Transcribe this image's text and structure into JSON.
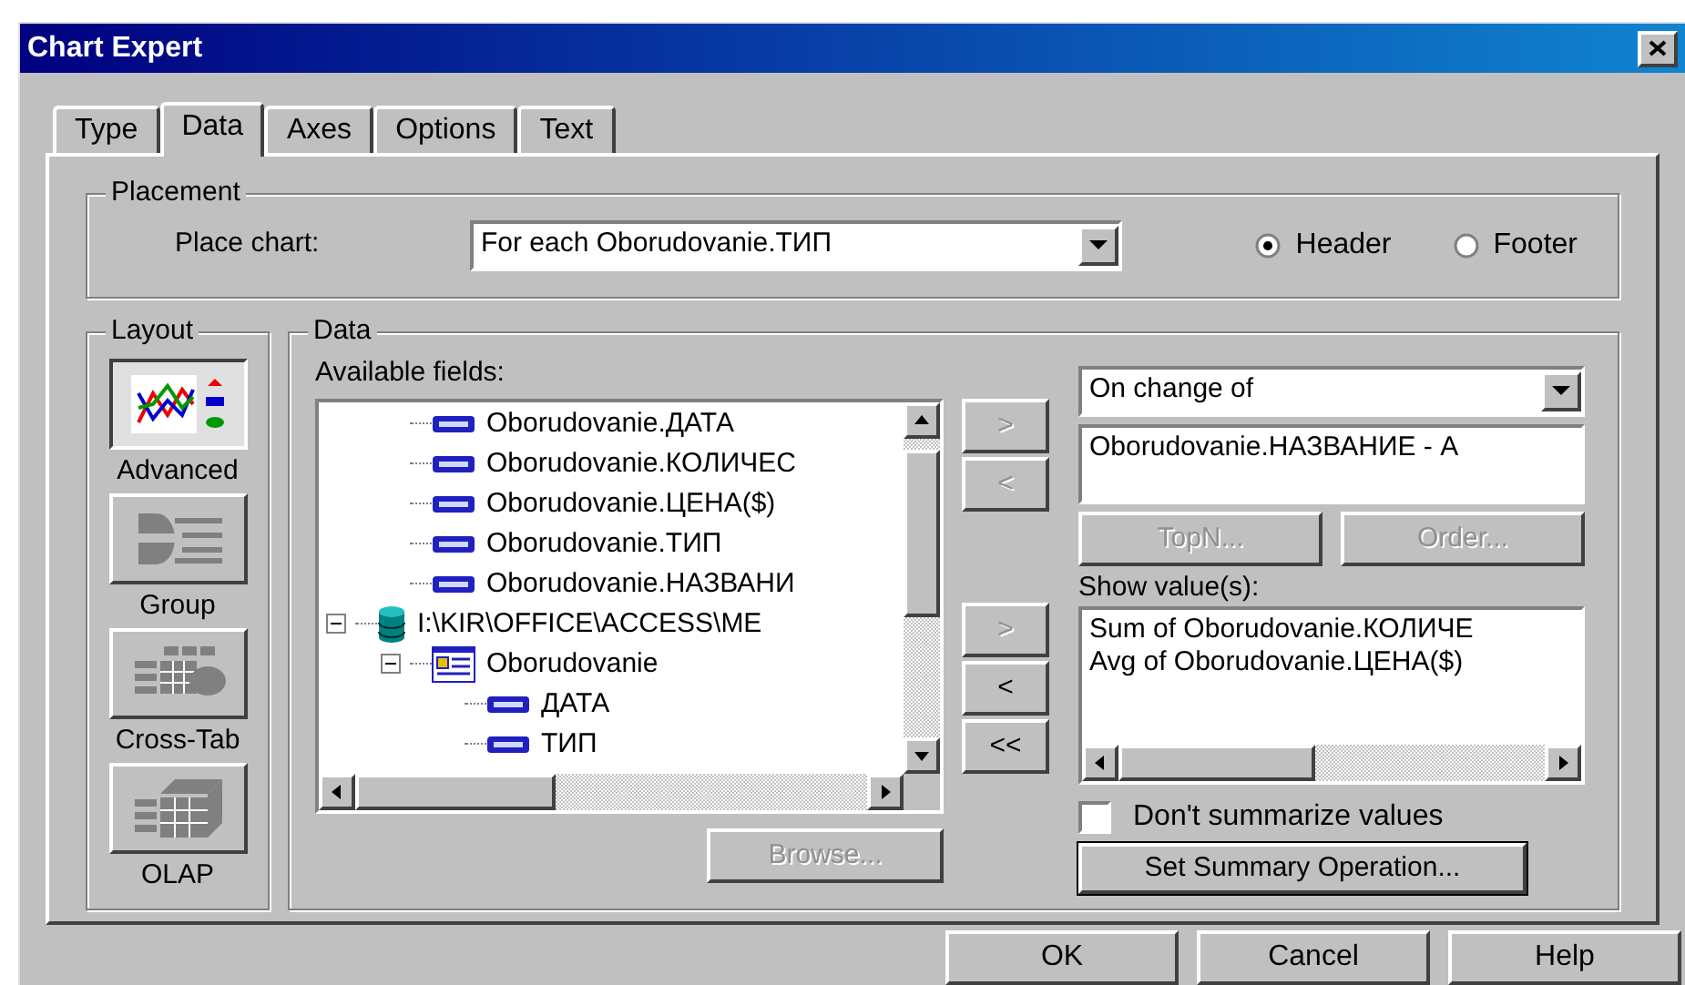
{
  "window": {
    "title": "Chart Expert"
  },
  "tabs": [
    {
      "label": "Type",
      "selected": false
    },
    {
      "label": "Data",
      "selected": true
    },
    {
      "label": "Axes",
      "selected": false
    },
    {
      "label": "Options",
      "selected": false
    },
    {
      "label": "Text",
      "selected": false
    }
  ],
  "placement": {
    "label": "Placement",
    "place_chart_label": "Place chart:",
    "place_chart_value": "For each Oborudovanie.ТИП",
    "radios": [
      {
        "label": "Header",
        "selected": true
      },
      {
        "label": "Footer",
        "selected": false
      }
    ]
  },
  "layout": {
    "label": "Layout",
    "items": [
      {
        "kind": "advanced",
        "label": "Advanced",
        "selected": true
      },
      {
        "kind": "group",
        "label": "Group",
        "selected": false
      },
      {
        "kind": "crosstab",
        "label": "Cross-Tab",
        "selected": false
      },
      {
        "kind": "olap",
        "label": "OLAP",
        "selected": false
      }
    ]
  },
  "data": {
    "label": "Data",
    "available_fields_label": "Available fields:",
    "tree": {
      "scrolled_branch": [
        {
          "kind": "field",
          "label": "Oborudovanie.ДАТА"
        },
        {
          "kind": "field",
          "label": "Oborudovanie.КОЛИЧЕС"
        },
        {
          "kind": "field",
          "label": "Oborudovanie.ЦЕНА($)"
        },
        {
          "kind": "field",
          "label": "Oborudovanie.ТИП"
        },
        {
          "kind": "field",
          "label": "Oborudovanie.НАЗВАНИ"
        }
      ],
      "nodes": [
        {
          "kind": "database",
          "label": "I:\\KIR\\OFFICE\\ACCESS\\ME",
          "expanded": true,
          "children": [
            {
              "kind": "table",
              "label": "Oborudovanie",
              "expanded": true,
              "children": [
                {
                  "kind": "field",
                  "label": "ДАТА"
                },
                {
                  "kind": "field",
                  "label": "ТИП"
                }
              ]
            }
          ]
        }
      ]
    },
    "browse_button": {
      "label": "Browse...",
      "disabled": true
    },
    "group_move_buttons": [
      {
        "label": ">",
        "disabled": true
      },
      {
        "label": "<",
        "disabled": true
      }
    ],
    "value_move_buttons": [
      {
        "label": ">",
        "disabled": true
      },
      {
        "label": "<",
        "disabled": false
      },
      {
        "label": "<<",
        "disabled": false
      }
    ],
    "on_change_dropdown": "On change of",
    "group_fields": [
      "Oborudovanie.НАЗВАНИЕ - A"
    ],
    "group_buttons": [
      {
        "label": "TopN...",
        "disabled": true
      },
      {
        "label": "Order...",
        "disabled": true
      }
    ],
    "show_values_label": "Show value(s):",
    "values": [
      "Sum of Oborudovanie.КОЛИЧЕ",
      "Avg of Oborudovanie.ЦЕНА($)"
    ],
    "dont_summarize": {
      "label": "Don't summarize values",
      "checked": false
    },
    "summary_button": {
      "label": "Set Summary Operation...",
      "disabled": false
    }
  },
  "buttons": [
    {
      "label": "OK"
    },
    {
      "label": "Cancel"
    },
    {
      "label": "Help"
    }
  ]
}
